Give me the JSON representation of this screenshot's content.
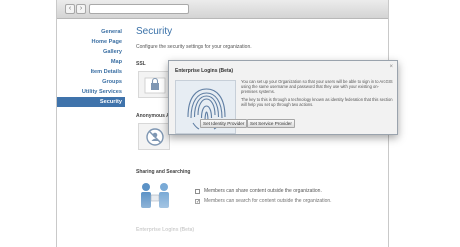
{
  "sidebar": {
    "items": [
      {
        "label": "General"
      },
      {
        "label": "Home Page"
      },
      {
        "label": "Gallery"
      },
      {
        "label": "Map"
      },
      {
        "label": "Item Details"
      },
      {
        "label": "Groups"
      },
      {
        "label": "Utility Services"
      },
      {
        "label": "Security",
        "active": true
      }
    ]
  },
  "main": {
    "title": "Security",
    "subtitle": "Configure the security settings for your organization.",
    "sections": {
      "ssl": "SSL",
      "anonymous": "Anonymous A",
      "sharing": "Sharing and Searching",
      "enterprise": "Enterprise Logins (Beta)"
    },
    "sharing_options": [
      {
        "label": "Members can share content outside the organization.",
        "checked": false
      },
      {
        "label": "Members can search for content outside the organization.",
        "checked": true
      }
    ]
  },
  "dialog": {
    "title": "Enterprise Logins (Beta)",
    "para1": "You can set up your Organization so that your users will be able to sign in to ArcGIS using the same username and password that they use with your existing on-premises systems.",
    "para2": "The key to this is through a technology known as identity federation that this section will help you set up through two actions.",
    "buttons": {
      "identity": "Set Identity Provider",
      "service": "Set Service Provider"
    }
  },
  "colors": {
    "accent": "#3f73ab",
    "link": "#3b6fa3"
  },
  "icons": [
    "back-icon",
    "forward-icon",
    "fingerprint-icon",
    "lock-icon",
    "no-anonymous-icon",
    "sharing-people-icon"
  ]
}
